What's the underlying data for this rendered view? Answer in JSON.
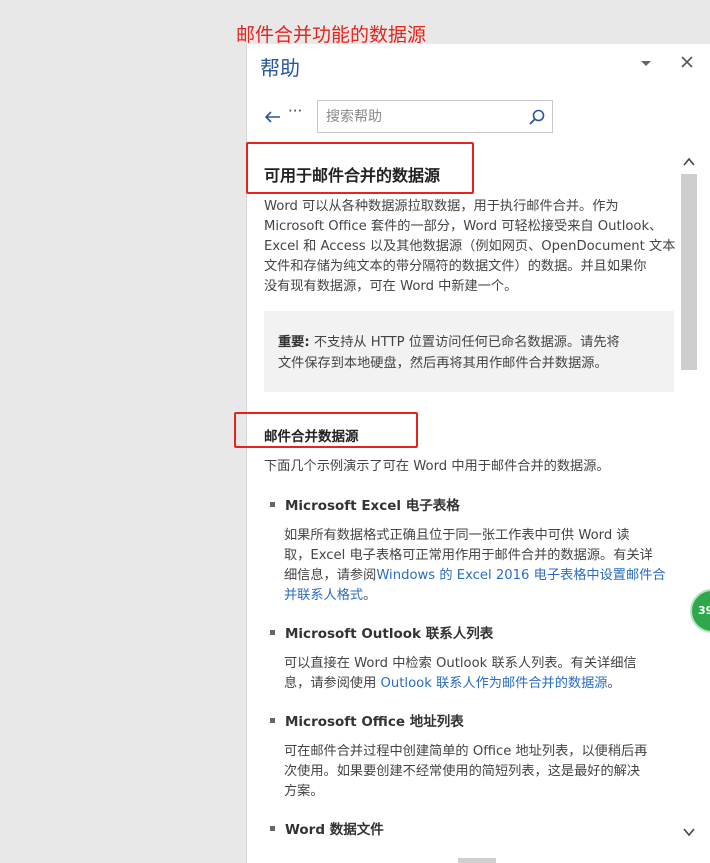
{
  "annotation": {
    "title": "邮件合并功能的数据源"
  },
  "pane": {
    "title": "帮助",
    "dropdown_icon": "chevron-down-icon",
    "close_icon": "close-icon"
  },
  "nav": {
    "back_icon": "back-arrow-icon",
    "more_label": "···",
    "search_placeholder": "搜索帮助",
    "search_value": "",
    "search_icon": "search-icon"
  },
  "article": {
    "heading": "可用于邮件合并的数据源",
    "intro_lines": [
      "Word 可以从各种数据源拉取数据，用于执行邮件合并。作为",
      "Microsoft Office 套件的一部分，Word 可轻松接受来自 Outlook、",
      "Excel 和 Access 以及其他数据源（例如网页、OpenDocument 文本",
      "文件和存储为纯文本的带分隔符的数据文件）的数据。并且如果你",
      "没有现有数据源，可在 Word 中新建一个。"
    ],
    "note_label": "重要:",
    "note_line1_rest": " 不支持从 HTTP 位置访问任何已命名数据源。请先将",
    "note_line2": "文件保存到本地硬盘，然后再将其用作邮件合并数据源。",
    "section_heading": "邮件合并数据源",
    "section_intro": "下面几个示例演示了可在 Word 中用于邮件合并的数据源。",
    "bullets": [
      {
        "title": "Microsoft Excel 电子表格",
        "line1": "如果所有数据格式正确且位于同一张工作表中可供 Word 读",
        "line2": "取，Excel 电子表格可正常用作用于邮件合并的数据源。有关详",
        "line3_pre": "细信息，请参阅",
        "line3_link": "Windows 的 Excel 2016 电子表格中设置邮件合",
        "line4_link": "并联系人格式",
        "line4_post": "。"
      },
      {
        "title": "Microsoft Outlook 联系人列表",
        "line1": "可以直接在 Word 中检索 Outlook 联系人列表。有关详细信",
        "line2_pre": "息，请参阅使用 ",
        "line2_link": "Outlook 联系人作为邮件合并的数据源",
        "line2_post": "。"
      },
      {
        "title": "Microsoft Office 地址列表",
        "line1": "可在邮件合并过程中创建简单的 Office 地址列表，以便稍后再",
        "line2": "次使用。如果要创建不经常使用的简短列表，这是最好的解决",
        "line3": "方案。"
      },
      {
        "title": "Word 数据文件"
      }
    ]
  },
  "badge": {
    "label": "39"
  },
  "colors": {
    "accent_blue": "#2b579a",
    "link_blue": "#2b6cc4",
    "annotation_red": "#e8231c",
    "badge_green": "#2ea84a"
  }
}
